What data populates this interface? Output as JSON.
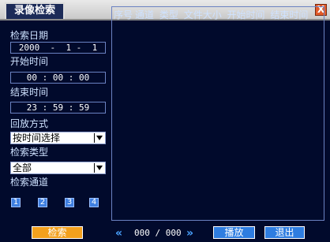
{
  "title": "录像检索",
  "close_label": "X",
  "search_date_label": "检索日期",
  "date": {
    "year": "2000",
    "month": "1",
    "day": "1"
  },
  "start_time_label": "开始时间",
  "start_time": "00 : 00 : 00",
  "end_time_label": "结束时间",
  "end_time": "23 : 59 : 59",
  "playback_mode_label": "回放方式",
  "playback_mode_value": "按时间选择",
  "search_type_label": "检索类型",
  "search_type_value": "全部",
  "search_channel_label": "检索通道",
  "channels": [
    "1",
    "2",
    "3",
    "4"
  ],
  "list_columns": [
    "序号",
    "通道",
    "类型",
    "文件大小",
    "开始时间",
    "结束时间"
  ],
  "pager": {
    "current": "000",
    "total": "000",
    "separator": "/"
  },
  "buttons": {
    "search": "检索",
    "play": "播放",
    "exit": "退出"
  }
}
